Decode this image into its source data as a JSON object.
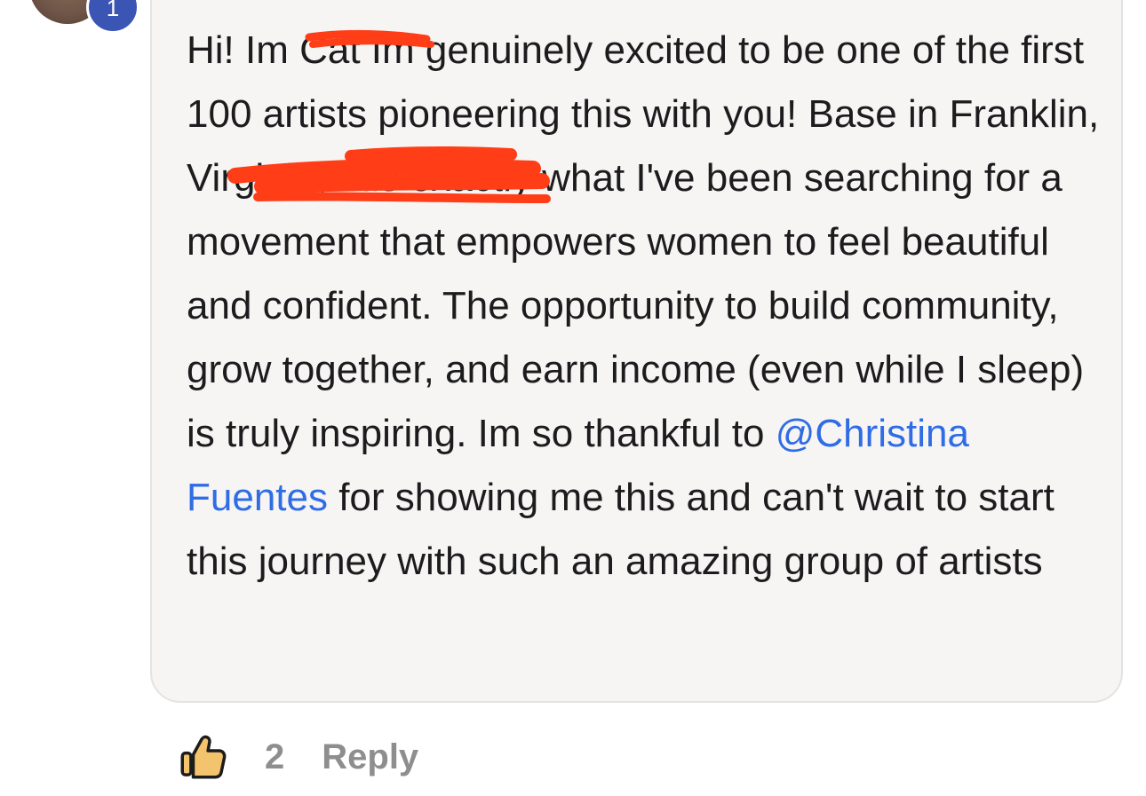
{
  "author": {
    "badge_count": "1"
  },
  "comment": {
    "text_before_mention": "Hi! Im Cat Im genuinely excited to be one of the first 100 artists pioneering this with you! Base in Franklin, Virginia, this exactly what I've been searching for a movement that empowers women to feel beautiful and confident. The opportunity to build community, grow together, and earn income (even while I sleep) is truly inspiring. Im so thankful to ",
    "mention": "@Christina Fuentes",
    "text_after_mention": " for showing me this and can't wait to start this journey with such an amazing group of artists"
  },
  "actions": {
    "like_icon": "thumbs-up-icon",
    "like_count": "2",
    "reply_label": "Reply"
  },
  "colors": {
    "mention": "#2f6ce5",
    "redaction": "#ff3d17",
    "bubble_background": "#f6f5f4",
    "action_text": "#8e8e8e",
    "badge": "#3a55b4"
  }
}
